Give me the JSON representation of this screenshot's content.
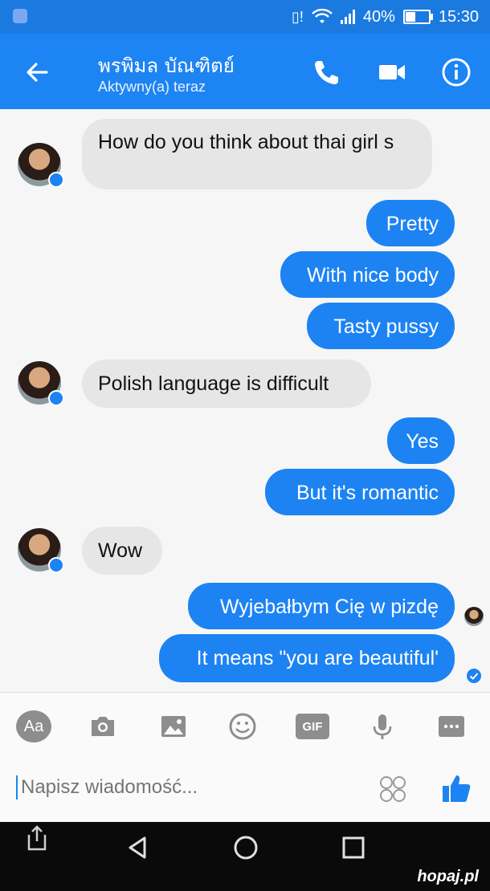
{
  "status_bar": {
    "battery": "40%",
    "time": "15:30"
  },
  "header": {
    "contact_name": "พรพิมล บัณฑิตย์",
    "contact_status": "Aktywny(a) teraz"
  },
  "messages": [
    {
      "direction": "in",
      "text": "How do you think about thai girl s"
    },
    {
      "direction": "out",
      "text": "Pretty"
    },
    {
      "direction": "out",
      "text": "With nice body"
    },
    {
      "direction": "out",
      "text": "Tasty pussy"
    },
    {
      "direction": "in",
      "text": "Polish language is difficult"
    },
    {
      "direction": "out",
      "text": "Yes"
    },
    {
      "direction": "out",
      "text": "But it's romantic"
    },
    {
      "direction": "in",
      "text": "Wow"
    },
    {
      "direction": "out",
      "text": "Wyjebałbym Cię w pizdę"
    },
    {
      "direction": "out",
      "text": "It means \"you are beautiful'"
    }
  ],
  "toolbar": {
    "text_button": "Aa",
    "gif_button": "GIF"
  },
  "composer": {
    "placeholder": "Napisz wiadomość..."
  },
  "watermark": "hopaj.pl",
  "colors": {
    "header": "#1d84f3",
    "status_bar": "#1a7ae0",
    "outgoing_bubble": "#1d83f2",
    "incoming_bubble": "#e6e6e6"
  }
}
